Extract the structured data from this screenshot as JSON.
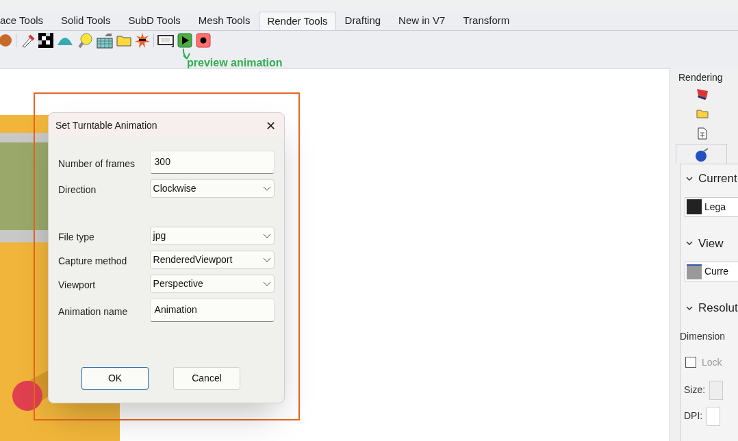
{
  "tabs": [
    {
      "label": "ace Tools",
      "selected": false
    },
    {
      "label": "Solid Tools",
      "selected": false
    },
    {
      "label": "SubD Tools",
      "selected": false
    },
    {
      "label": "Mesh Tools",
      "selected": false
    },
    {
      "label": "Render Tools",
      "selected": true
    },
    {
      "label": "Drafting",
      "selected": false
    },
    {
      "label": "New in V7",
      "selected": false
    },
    {
      "label": "Transform",
      "selected": false
    }
  ],
  "toolbar": {
    "annotation": "preview animation"
  },
  "dialog": {
    "title": "Set Turntable Animation",
    "close": "✕",
    "groups": [
      [
        {
          "kind": "text",
          "label": "Number of frames",
          "value": "300"
        },
        {
          "kind": "dropdown",
          "label": "Direction",
          "value": "Clockwise"
        }
      ],
      [
        {
          "kind": "dropdown",
          "label": "File type",
          "value": "jpg"
        },
        {
          "kind": "dropdown",
          "label": "Capture method",
          "value": "RenderedViewport"
        },
        {
          "kind": "dropdown",
          "label": "Viewport",
          "value": "Perspective"
        },
        {
          "kind": "text",
          "label": "Animation name",
          "value": "Animation"
        }
      ]
    ],
    "buttons": [
      "OK",
      "Cancel"
    ]
  },
  "panel": {
    "title": "Rendering",
    "sections": [
      {
        "title": "Current",
        "expanded": true,
        "item": "Lega"
      },
      {
        "title": "View",
        "expanded": true,
        "item": "Curre"
      },
      {
        "title": "Resolut",
        "expanded": true
      }
    ],
    "dimensions_label": "Dimension",
    "lock": {
      "label": "Lock",
      "checked": false
    },
    "size_label": "Size:",
    "dpi_label": "DPI:"
  }
}
